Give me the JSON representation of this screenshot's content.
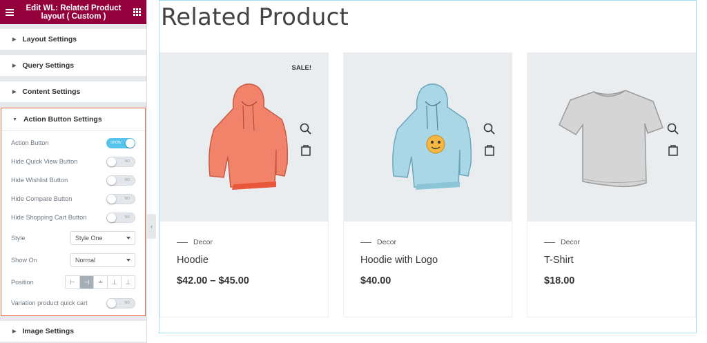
{
  "panel": {
    "title": "Edit WL: Related Product layout ( Custom )",
    "sections": {
      "layout": "Layout Settings",
      "query": "Query Settings",
      "content": "Content Settings",
      "action": "Action Button Settings",
      "image": "Image Settings"
    },
    "controls": {
      "action_button": {
        "label": "Action Button",
        "state": "SHOW"
      },
      "hide_quick_view": {
        "label": "Hide Quick View Button",
        "state": "NO"
      },
      "hide_wishlist": {
        "label": "Hide Wishlist Button",
        "state": "NO"
      },
      "hide_compare": {
        "label": "Hide Compare Button",
        "state": "NO"
      },
      "hide_cart": {
        "label": "Hide Shopping Cart Button",
        "state": "NO"
      },
      "style": {
        "label": "Style",
        "value": "Style One"
      },
      "show_on": {
        "label": "Show On",
        "value": "Normal"
      },
      "position": {
        "label": "Position"
      },
      "variation_quick_cart": {
        "label": "Variation product quick cart",
        "state": "NO"
      }
    }
  },
  "preview": {
    "heading": "Related Product",
    "products": [
      {
        "badge": "SALE!",
        "category": "Decor",
        "name": "Hoodie",
        "price": "$42.00 – $45.00"
      },
      {
        "badge": "",
        "category": "Decor",
        "name": "Hoodie with Logo",
        "price": "$40.00"
      },
      {
        "badge": "",
        "category": "Decor",
        "name": "T-Shirt",
        "price": "$18.00"
      }
    ]
  },
  "colors": {
    "brand": "#93003c",
    "highlight_border": "#e9633d",
    "toggle_on": "#58c3ea",
    "image_bg": "#eaedf0",
    "hoodie_1": "#f2836b",
    "hoodie_2": "#a9d7e6",
    "tshirt": "#d5d5d5"
  }
}
